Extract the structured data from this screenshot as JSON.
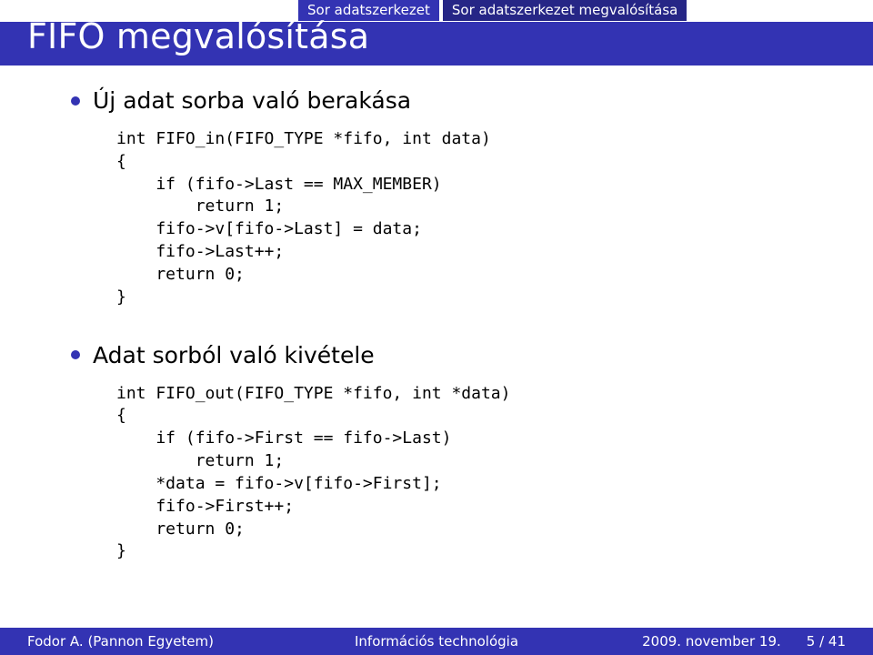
{
  "tabs": {
    "section": "Sor adatszerkezet",
    "subsection": "Sor adatszerkezet megvalósítása"
  },
  "title": "FIFO megvalósítása",
  "bullets": {
    "item1": "Új adat sorba való berakása",
    "item2": "Adat sorból való kivétele"
  },
  "code": {
    "block1": "int FIFO_in(FIFO_TYPE *fifo, int data)\n{\n    if (fifo->Last == MAX_MEMBER)\n        return 1;\n    fifo->v[fifo->Last] = data;\n    fifo->Last++;\n    return 0;\n}",
    "block2": "int FIFO_out(FIFO_TYPE *fifo, int *data)\n{\n    if (fifo->First == fifo->Last)\n        return 1;\n    *data = fifo->v[fifo->First];\n    fifo->First++;\n    return 0;\n}"
  },
  "footer": {
    "author": "Fodor A. (Pannon Egyetem)",
    "course": "Információs technológia",
    "date": "2009. november 19.",
    "page": "5 / 41"
  }
}
